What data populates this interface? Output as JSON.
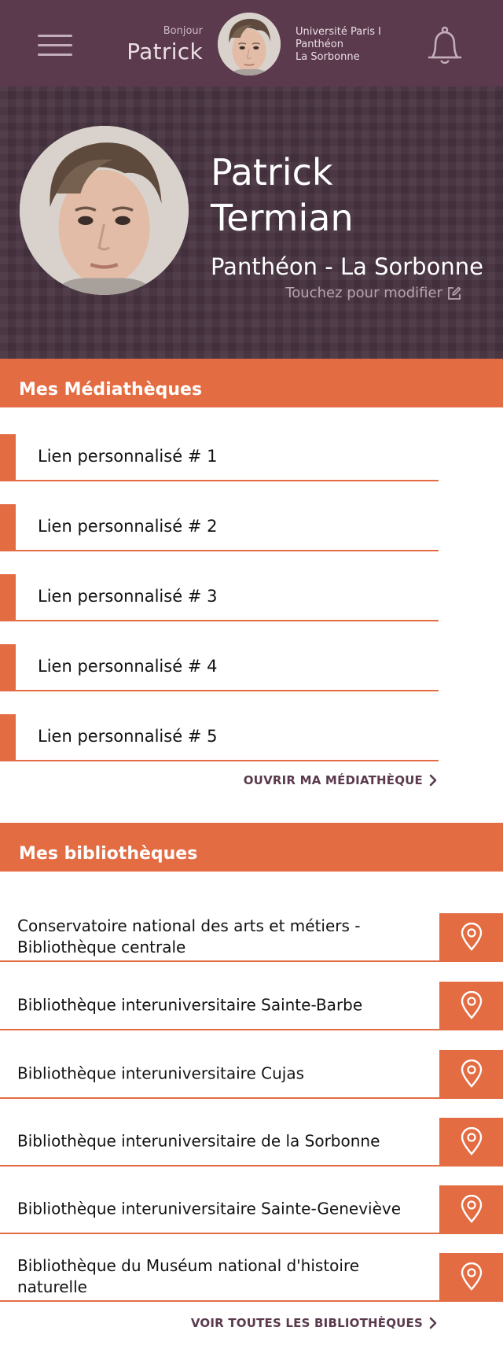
{
  "header": {
    "greeting": "Bonjour",
    "user_first_name": "Patrick",
    "university_lines": [
      "Université Paris I",
      "Panthéon",
      "La Sorbonne"
    ],
    "menu_icon": "hamburger-menu-icon",
    "notifications_icon": "bell-icon"
  },
  "profile": {
    "first_name": "Patrick",
    "last_name": "Termian",
    "institution": "Panthéon - La Sorbonne",
    "edit_hint": "Touchez pour modifier",
    "edit_icon": "edit-icon"
  },
  "mediatheques": {
    "title": "Mes Médiathèques",
    "links": [
      "Lien personnalisé # 1",
      "Lien personnalisé # 2",
      "Lien personnalisé # 3",
      "Lien personnalisé # 4",
      "Lien personnalisé # 5"
    ],
    "open_label": "OUVRIR MA MÉDIATHÈQUE"
  },
  "bibliotheques": {
    "title": "Mes bibliothèques",
    "items": [
      "Conservatoire national des arts et métiers - Bibliothèque centrale",
      "Bibliothèque interuniversitaire Sainte-Barbe",
      "Bibliothèque interuniversitaire Cujas",
      "Bibliothèque interuniversitaire de la Sorbonne",
      "Bibliothèque interuniversitaire Sainte-Geneviève",
      "Bibliothèque du Muséum national d'histoire naturelle"
    ],
    "item_icon": "map-pin-icon",
    "see_all_label": "VOIR TOUTES LES BIBLIOTHÈQUES"
  },
  "colors": {
    "accent": "#e36c42",
    "header_bg": "#5a3a4c",
    "hero_bg": "#473340",
    "link_text_dark": "#5a3a4c"
  }
}
